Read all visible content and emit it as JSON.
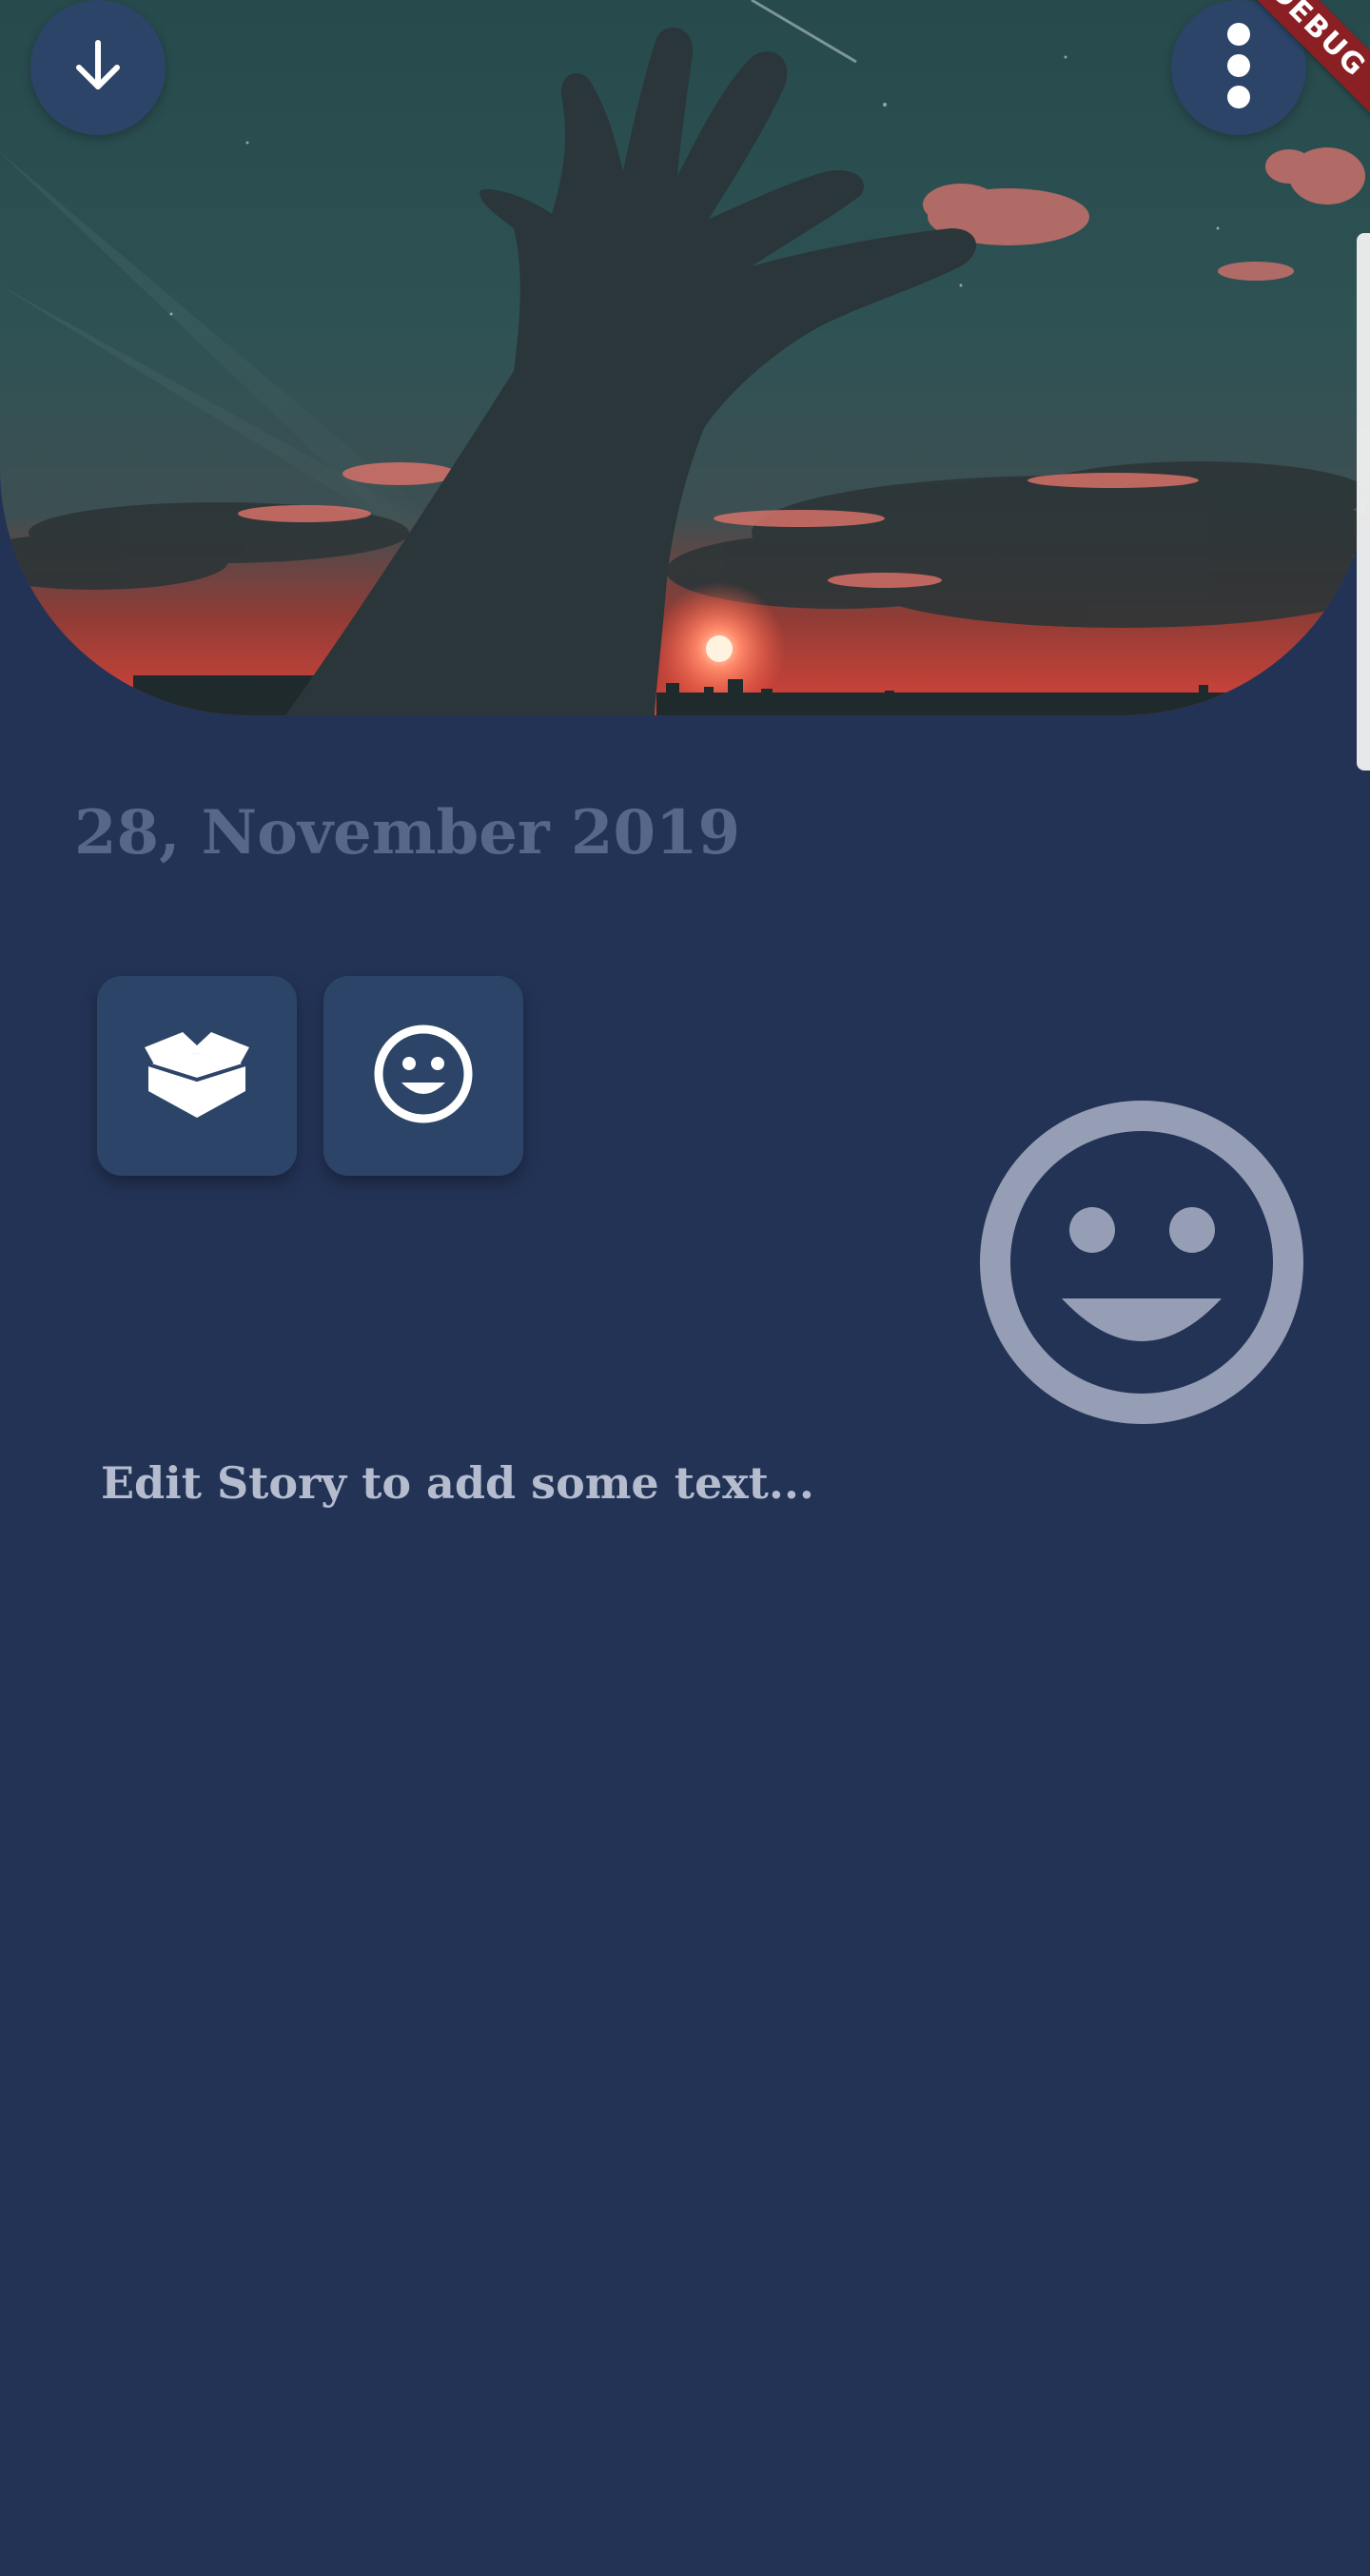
{
  "header": {
    "back_icon": "arrow-down-icon",
    "menu_icon": "more-vert-icon",
    "debug_banner": "DEBUG"
  },
  "entry": {
    "date": "28, November 2019",
    "mood_icon": "smile-face-icon",
    "story_placeholder": "Edit Story to add some text..."
  },
  "actions": {
    "archive_icon": "box-open-icon",
    "mood_icon": "smile-face-icon"
  },
  "colors": {
    "background": "#233356",
    "button_bg": "#2c4468",
    "date_text": "#56678a",
    "story_text": "#b4bccd",
    "mood_icon": "#959eb4",
    "debug_banner": "#8a1f24"
  }
}
